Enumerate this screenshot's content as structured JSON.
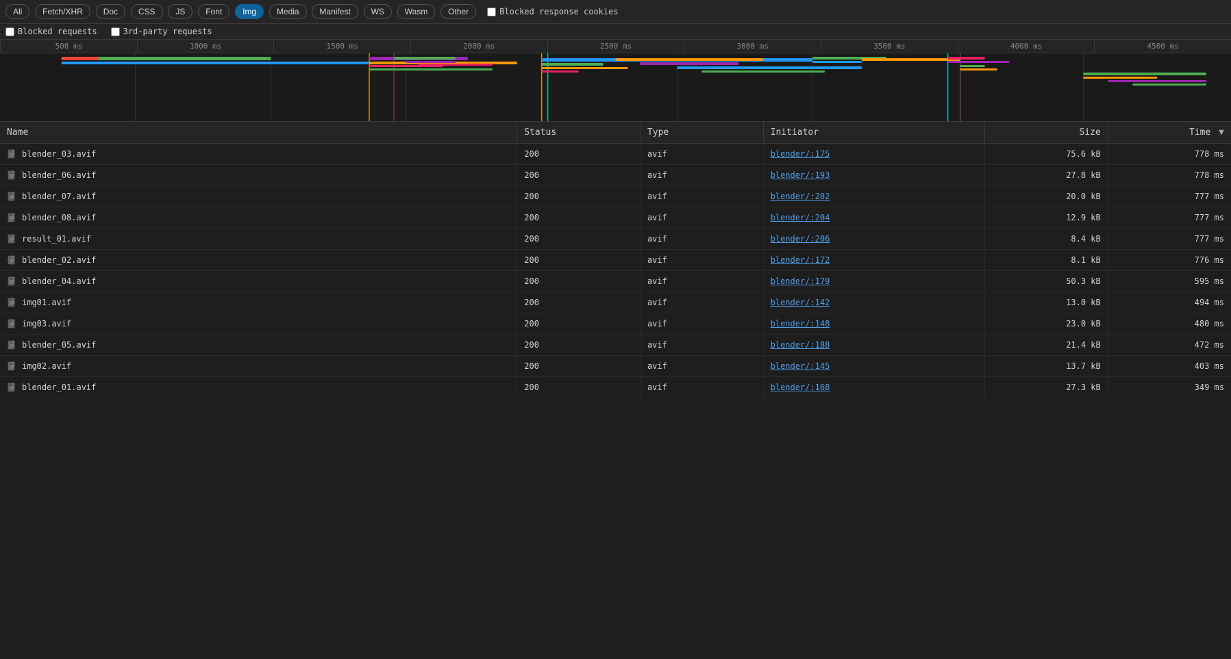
{
  "filterButtons": [
    {
      "id": "all",
      "label": "All",
      "active": false
    },
    {
      "id": "fetch-xhr",
      "label": "Fetch/XHR",
      "active": false
    },
    {
      "id": "doc",
      "label": "Doc",
      "active": false
    },
    {
      "id": "css",
      "label": "CSS",
      "active": false
    },
    {
      "id": "js",
      "label": "JS",
      "active": false
    },
    {
      "id": "font",
      "label": "Font",
      "active": false
    },
    {
      "id": "img",
      "label": "Img",
      "active": true
    },
    {
      "id": "media",
      "label": "Media",
      "active": false
    },
    {
      "id": "manifest",
      "label": "Manifest",
      "active": false
    },
    {
      "id": "ws",
      "label": "WS",
      "active": false
    },
    {
      "id": "wasm",
      "label": "Wasm",
      "active": false
    },
    {
      "id": "other",
      "label": "Other",
      "active": false
    }
  ],
  "checkboxes": {
    "blocked_response_cookies": {
      "label": "Blocked response cookies",
      "checked": false
    },
    "blocked_requests": {
      "label": "Blocked requests",
      "checked": false
    },
    "third_party_requests": {
      "label": "3rd-party requests",
      "checked": false
    }
  },
  "timeline": {
    "ticks": [
      "500 ms",
      "1000 ms",
      "1500 ms",
      "2000 ms",
      "2500 ms",
      "3000 ms",
      "3500 ms",
      "4000 ms",
      "4500 ms"
    ]
  },
  "table": {
    "columns": [
      {
        "id": "name",
        "label": "Name"
      },
      {
        "id": "status",
        "label": "Status"
      },
      {
        "id": "type",
        "label": "Type"
      },
      {
        "id": "initiator",
        "label": "Initiator"
      },
      {
        "id": "size",
        "label": "Size"
      },
      {
        "id": "time",
        "label": "Time",
        "sorted": true
      }
    ],
    "rows": [
      {
        "name": "blender_03.avif",
        "status": "200",
        "type": "avif",
        "initiator": "blender/:175",
        "size": "75.6 kB",
        "time": "778 ms"
      },
      {
        "name": "blender_06.avif",
        "status": "200",
        "type": "avif",
        "initiator": "blender/:193",
        "size": "27.8 kB",
        "time": "778 ms"
      },
      {
        "name": "blender_07.avif",
        "status": "200",
        "type": "avif",
        "initiator": "blender/:202",
        "size": "20.0 kB",
        "time": "777 ms"
      },
      {
        "name": "blender_08.avif",
        "status": "200",
        "type": "avif",
        "initiator": "blender/:204",
        "size": "12.9 kB",
        "time": "777 ms"
      },
      {
        "name": "result_01.avif",
        "status": "200",
        "type": "avif",
        "initiator": "blender/:206",
        "size": "8.4 kB",
        "time": "777 ms"
      },
      {
        "name": "blender_02.avif",
        "status": "200",
        "type": "avif",
        "initiator": "blender/:172",
        "size": "8.1 kB",
        "time": "776 ms"
      },
      {
        "name": "blender_04.avif",
        "status": "200",
        "type": "avif",
        "initiator": "blender/:179",
        "size": "50.3 kB",
        "time": "595 ms"
      },
      {
        "name": "img01.avif",
        "status": "200",
        "type": "avif",
        "initiator": "blender/:142",
        "size": "13.0 kB",
        "time": "494 ms"
      },
      {
        "name": "img03.avif",
        "status": "200",
        "type": "avif",
        "initiator": "blender/:148",
        "size": "23.0 kB",
        "time": "480 ms"
      },
      {
        "name": "blender_05.avif",
        "status": "200",
        "type": "avif",
        "initiator": "blender/:188",
        "size": "21.4 kB",
        "time": "472 ms"
      },
      {
        "name": "img02.avif",
        "status": "200",
        "type": "avif",
        "initiator": "blender/:145",
        "size": "13.7 kB",
        "time": "403 ms"
      },
      {
        "name": "blender_01.avif",
        "status": "200",
        "type": "avif",
        "initiator": "blender/:168",
        "size": "27.3 kB",
        "time": "349 ms"
      }
    ]
  }
}
